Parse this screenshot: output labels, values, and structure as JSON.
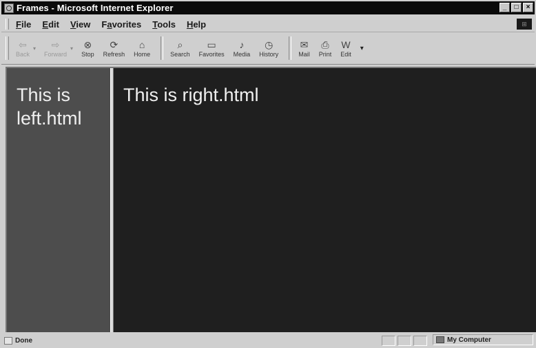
{
  "window": {
    "title": "Frames - Microsoft Internet Explorer"
  },
  "menu": [
    {
      "key": "F",
      "rest": "ile"
    },
    {
      "key": "E",
      "rest": "dit"
    },
    {
      "key": "V",
      "rest": "iew"
    },
    {
      "pre": "F",
      "key": "a",
      "rest": "vorites"
    },
    {
      "key": "T",
      "rest": "ools"
    },
    {
      "key": "H",
      "rest": "elp"
    }
  ],
  "toolbar": {
    "back": {
      "label": "Back",
      "icon": "back-arrow-icon",
      "glyph": "⇦"
    },
    "forward": {
      "label": "Forward",
      "icon": "forward-arrow-icon",
      "glyph": "⇨"
    },
    "stop": {
      "label": "Stop",
      "icon": "stop-icon",
      "glyph": "⊗"
    },
    "refresh": {
      "label": "Refresh",
      "icon": "refresh-icon",
      "glyph": "⟳"
    },
    "home": {
      "label": "Home",
      "icon": "home-icon",
      "glyph": "⌂"
    },
    "search": {
      "label": "Search",
      "icon": "search-icon",
      "glyph": "⌕"
    },
    "favorites": {
      "label": "Favorites",
      "icon": "favorites-folder-icon",
      "glyph": "▭"
    },
    "media": {
      "label": "Media",
      "icon": "media-icon",
      "glyph": "♪"
    },
    "history": {
      "label": "History",
      "icon": "history-icon",
      "glyph": "◷"
    },
    "mail": {
      "label": "Mail",
      "icon": "mail-icon",
      "glyph": "✉"
    },
    "print": {
      "label": "Print",
      "icon": "print-icon",
      "glyph": "⎙"
    },
    "edit": {
      "label": "Edit",
      "icon": "edit-icon",
      "glyph": "W"
    },
    "more": "▾"
  },
  "frames": {
    "left_text": "This is left.html",
    "right_text": "This is right.html"
  },
  "status": {
    "text": "Done",
    "zone": "My Computer"
  }
}
